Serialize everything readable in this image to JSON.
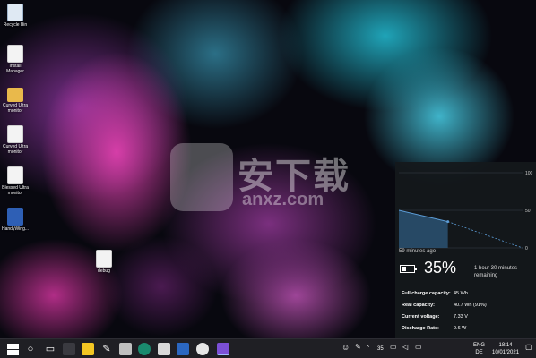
{
  "desktop": {
    "icons": [
      {
        "label": "Recycle Bin",
        "kind": "bin"
      },
      {
        "label": "Install Manager",
        "kind": "doc"
      },
      {
        "label": "Curved Ultra monitor",
        "kind": "folder"
      },
      {
        "label": "Curved Ultra monitor",
        "kind": "doc"
      },
      {
        "label": "Blessed Ultra monitor",
        "kind": "doc"
      },
      {
        "label": "HandyWing...",
        "kind": "blue"
      },
      {
        "label": "debug",
        "kind": "doc"
      }
    ]
  },
  "watermark": {
    "title": "安下载",
    "domain": "anxz.com"
  },
  "battery": {
    "chart": {
      "type": "line",
      "y_ticks": [
        "100",
        "50",
        "0"
      ],
      "history": [
        [
          0,
          50
        ],
        [
          59,
          35
        ]
      ],
      "projection": [
        [
          59,
          35
        ],
        [
          149,
          0
        ]
      ],
      "ylim": [
        0,
        100
      ]
    },
    "time_ago": "59 minutes ago",
    "percent": "35%",
    "percent_value": 0.35,
    "remaining": "1 hour 30 minutes remaining",
    "stats": [
      {
        "label": "Full charge capacity:",
        "value": "45 Wh"
      },
      {
        "label": "Real capacity:",
        "value": "40.7 Wh (91%)"
      },
      {
        "label": "Current voltage:",
        "value": "7.33 V"
      },
      {
        "label": "Discharge Rate:",
        "value": "9.6 W"
      }
    ]
  },
  "taskbar": {
    "apps": [
      "search-icon",
      "task-view-icon",
      "sticky-notes-icon",
      "paint-icon",
      "edge-icon",
      "file-explorer-icon",
      "mail-icon",
      "word-icon",
      "chrome-icon",
      "visual-studio-icon"
    ],
    "tray_number": "35",
    "language_top": "ENG",
    "language_bottom": "DE",
    "time": "18:14",
    "date": "10/01/2021"
  },
  "colors": {
    "accent": "#5b9bd5",
    "panel_bg": "#14181c",
    "taskbar_bg": "#1f1f24"
  }
}
